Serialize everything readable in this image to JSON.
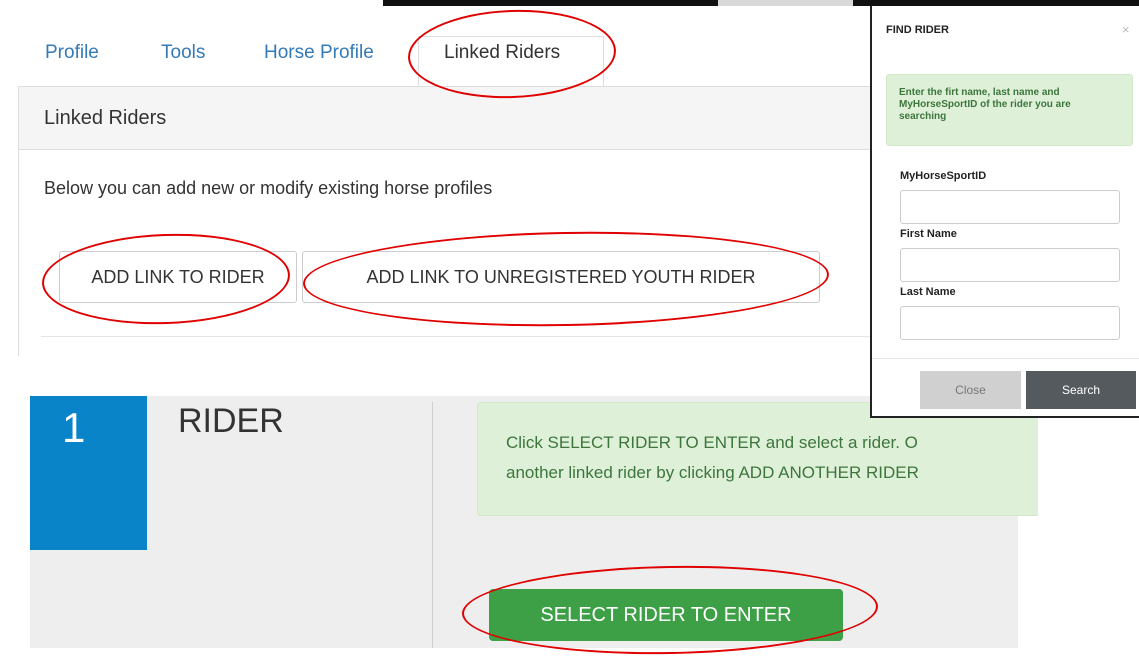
{
  "tabs": {
    "items": [
      {
        "label": "Profile"
      },
      {
        "label": "Tools"
      },
      {
        "label": "Horse Profile"
      },
      {
        "label": "Linked Riders"
      }
    ]
  },
  "panel": {
    "title": "Linked Riders",
    "description": "Below you can add new or modify existing horse profiles",
    "buttons": {
      "add_link": "ADD LINK TO RIDER",
      "add_unregistered": "ADD LINK TO UNREGISTERED YOUTH RIDER"
    }
  },
  "rider": {
    "number": "1",
    "title": "RIDER",
    "alert_line1": "Click SELECT RIDER TO ENTER and select a rider. O",
    "alert_line2": "another linked rider by clicking ADD ANOTHER RIDER",
    "select_button": "SELECT RIDER TO ENTER"
  },
  "modal": {
    "title": "FIND RIDER",
    "close_x": "×",
    "alert_lines": [
      "Enter the firt name, last name and",
      "MyHorseSportID of the rider you are",
      "searching"
    ],
    "fields": {
      "id_label": "MyHorseSportID",
      "first_label": "First Name",
      "last_label": "Last Name"
    },
    "close_button": "Close",
    "search_button": "Search"
  },
  "colors": {
    "link_blue": "#337ab7",
    "annotation_red": "#e00000",
    "rider_blue": "#0a84c8",
    "success_green": "#3ea046",
    "alert_green_bg": "#dff0d8",
    "alert_green_text": "#3c763d"
  }
}
